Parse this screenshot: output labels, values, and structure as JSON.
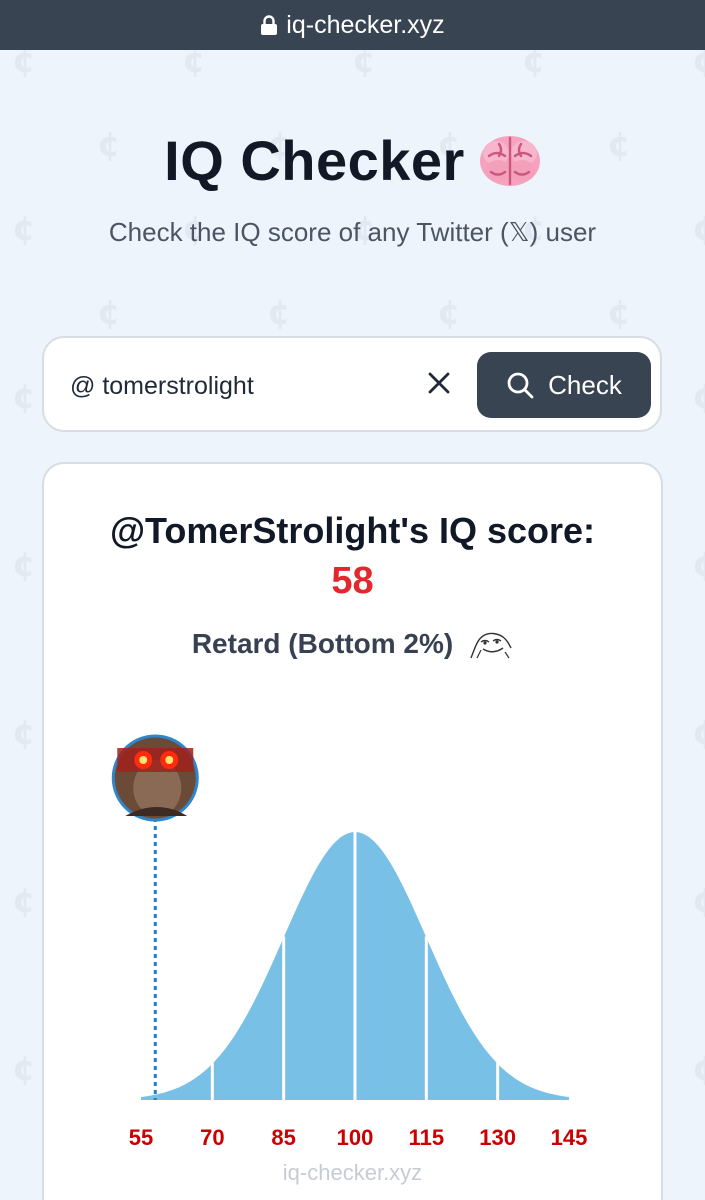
{
  "browser": {
    "url": "iq-checker.xyz"
  },
  "header": {
    "title": "IQ Checker",
    "title_icon": "brain-emoji",
    "subtitle": "Check the IQ score of any Twitter (𝕏) user"
  },
  "search": {
    "value": "@ tomerstrolight",
    "button_label": "Check"
  },
  "result": {
    "heading": "@TomerStrolight's IQ score:",
    "score": "58",
    "category": "Retard (Bottom 2%)",
    "watermark": "iq-checker.xyz"
  },
  "colors": {
    "accent": "#384452",
    "score": "#e3282d",
    "curve": "#79c0e7",
    "tick_labels": "#cc0000"
  },
  "chart_data": {
    "type": "area",
    "description_type": "normal-distribution",
    "mean": 100,
    "sd": 15,
    "x_ticks": [
      55,
      70,
      85,
      100,
      115,
      130,
      145
    ],
    "xlim": [
      55,
      145
    ],
    "marker": {
      "x": 58
    }
  }
}
